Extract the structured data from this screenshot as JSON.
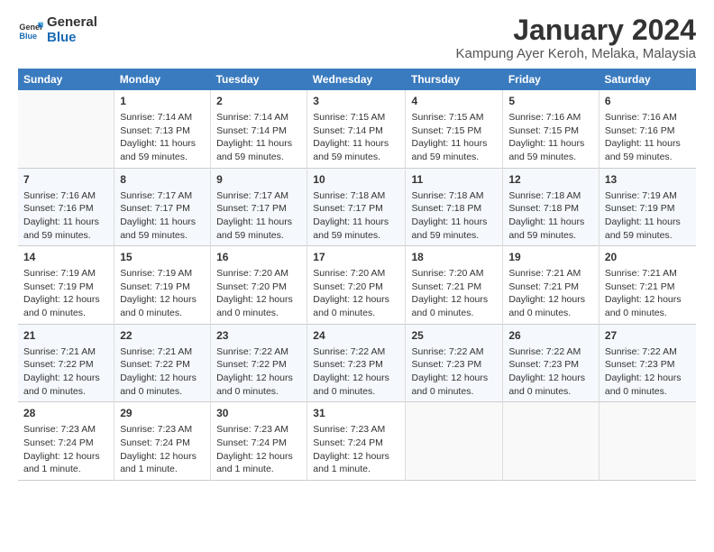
{
  "logo": {
    "line1": "General",
    "line2": "Blue"
  },
  "title": "January 2024",
  "location": "Kampung Ayer Keroh, Melaka, Malaysia",
  "weekdays": [
    "Sunday",
    "Monday",
    "Tuesday",
    "Wednesday",
    "Thursday",
    "Friday",
    "Saturday"
  ],
  "weeks": [
    [
      {
        "day": "",
        "sunrise": "",
        "sunset": "",
        "daylight": ""
      },
      {
        "day": "1",
        "sunrise": "Sunrise: 7:14 AM",
        "sunset": "Sunset: 7:13 PM",
        "daylight": "Daylight: 11 hours and 59 minutes."
      },
      {
        "day": "2",
        "sunrise": "Sunrise: 7:14 AM",
        "sunset": "Sunset: 7:14 PM",
        "daylight": "Daylight: 11 hours and 59 minutes."
      },
      {
        "day": "3",
        "sunrise": "Sunrise: 7:15 AM",
        "sunset": "Sunset: 7:14 PM",
        "daylight": "Daylight: 11 hours and 59 minutes."
      },
      {
        "day": "4",
        "sunrise": "Sunrise: 7:15 AM",
        "sunset": "Sunset: 7:15 PM",
        "daylight": "Daylight: 11 hours and 59 minutes."
      },
      {
        "day": "5",
        "sunrise": "Sunrise: 7:16 AM",
        "sunset": "Sunset: 7:15 PM",
        "daylight": "Daylight: 11 hours and 59 minutes."
      },
      {
        "day": "6",
        "sunrise": "Sunrise: 7:16 AM",
        "sunset": "Sunset: 7:16 PM",
        "daylight": "Daylight: 11 hours and 59 minutes."
      }
    ],
    [
      {
        "day": "7",
        "sunrise": "Sunrise: 7:16 AM",
        "sunset": "Sunset: 7:16 PM",
        "daylight": "Daylight: 11 hours and 59 minutes."
      },
      {
        "day": "8",
        "sunrise": "Sunrise: 7:17 AM",
        "sunset": "Sunset: 7:17 PM",
        "daylight": "Daylight: 11 hours and 59 minutes."
      },
      {
        "day": "9",
        "sunrise": "Sunrise: 7:17 AM",
        "sunset": "Sunset: 7:17 PM",
        "daylight": "Daylight: 11 hours and 59 minutes."
      },
      {
        "day": "10",
        "sunrise": "Sunrise: 7:18 AM",
        "sunset": "Sunset: 7:17 PM",
        "daylight": "Daylight: 11 hours and 59 minutes."
      },
      {
        "day": "11",
        "sunrise": "Sunrise: 7:18 AM",
        "sunset": "Sunset: 7:18 PM",
        "daylight": "Daylight: 11 hours and 59 minutes."
      },
      {
        "day": "12",
        "sunrise": "Sunrise: 7:18 AM",
        "sunset": "Sunset: 7:18 PM",
        "daylight": "Daylight: 11 hours and 59 minutes."
      },
      {
        "day": "13",
        "sunrise": "Sunrise: 7:19 AM",
        "sunset": "Sunset: 7:19 PM",
        "daylight": "Daylight: 11 hours and 59 minutes."
      }
    ],
    [
      {
        "day": "14",
        "sunrise": "Sunrise: 7:19 AM",
        "sunset": "Sunset: 7:19 PM",
        "daylight": "Daylight: 12 hours and 0 minutes."
      },
      {
        "day": "15",
        "sunrise": "Sunrise: 7:19 AM",
        "sunset": "Sunset: 7:19 PM",
        "daylight": "Daylight: 12 hours and 0 minutes."
      },
      {
        "day": "16",
        "sunrise": "Sunrise: 7:20 AM",
        "sunset": "Sunset: 7:20 PM",
        "daylight": "Daylight: 12 hours and 0 minutes."
      },
      {
        "day": "17",
        "sunrise": "Sunrise: 7:20 AM",
        "sunset": "Sunset: 7:20 PM",
        "daylight": "Daylight: 12 hours and 0 minutes."
      },
      {
        "day": "18",
        "sunrise": "Sunrise: 7:20 AM",
        "sunset": "Sunset: 7:21 PM",
        "daylight": "Daylight: 12 hours and 0 minutes."
      },
      {
        "day": "19",
        "sunrise": "Sunrise: 7:21 AM",
        "sunset": "Sunset: 7:21 PM",
        "daylight": "Daylight: 12 hours and 0 minutes."
      },
      {
        "day": "20",
        "sunrise": "Sunrise: 7:21 AM",
        "sunset": "Sunset: 7:21 PM",
        "daylight": "Daylight: 12 hours and 0 minutes."
      }
    ],
    [
      {
        "day": "21",
        "sunrise": "Sunrise: 7:21 AM",
        "sunset": "Sunset: 7:22 PM",
        "daylight": "Daylight: 12 hours and 0 minutes."
      },
      {
        "day": "22",
        "sunrise": "Sunrise: 7:21 AM",
        "sunset": "Sunset: 7:22 PM",
        "daylight": "Daylight: 12 hours and 0 minutes."
      },
      {
        "day": "23",
        "sunrise": "Sunrise: 7:22 AM",
        "sunset": "Sunset: 7:22 PM",
        "daylight": "Daylight: 12 hours and 0 minutes."
      },
      {
        "day": "24",
        "sunrise": "Sunrise: 7:22 AM",
        "sunset": "Sunset: 7:23 PM",
        "daylight": "Daylight: 12 hours and 0 minutes."
      },
      {
        "day": "25",
        "sunrise": "Sunrise: 7:22 AM",
        "sunset": "Sunset: 7:23 PM",
        "daylight": "Daylight: 12 hours and 0 minutes."
      },
      {
        "day": "26",
        "sunrise": "Sunrise: 7:22 AM",
        "sunset": "Sunset: 7:23 PM",
        "daylight": "Daylight: 12 hours and 0 minutes."
      },
      {
        "day": "27",
        "sunrise": "Sunrise: 7:22 AM",
        "sunset": "Sunset: 7:23 PM",
        "daylight": "Daylight: 12 hours and 0 minutes."
      }
    ],
    [
      {
        "day": "28",
        "sunrise": "Sunrise: 7:23 AM",
        "sunset": "Sunset: 7:24 PM",
        "daylight": "Daylight: 12 hours and 1 minute."
      },
      {
        "day": "29",
        "sunrise": "Sunrise: 7:23 AM",
        "sunset": "Sunset: 7:24 PM",
        "daylight": "Daylight: 12 hours and 1 minute."
      },
      {
        "day": "30",
        "sunrise": "Sunrise: 7:23 AM",
        "sunset": "Sunset: 7:24 PM",
        "daylight": "Daylight: 12 hours and 1 minute."
      },
      {
        "day": "31",
        "sunrise": "Sunrise: 7:23 AM",
        "sunset": "Sunset: 7:24 PM",
        "daylight": "Daylight: 12 hours and 1 minute."
      },
      {
        "day": "",
        "sunrise": "",
        "sunset": "",
        "daylight": ""
      },
      {
        "day": "",
        "sunrise": "",
        "sunset": "",
        "daylight": ""
      },
      {
        "day": "",
        "sunrise": "",
        "sunset": "",
        "daylight": ""
      }
    ]
  ]
}
